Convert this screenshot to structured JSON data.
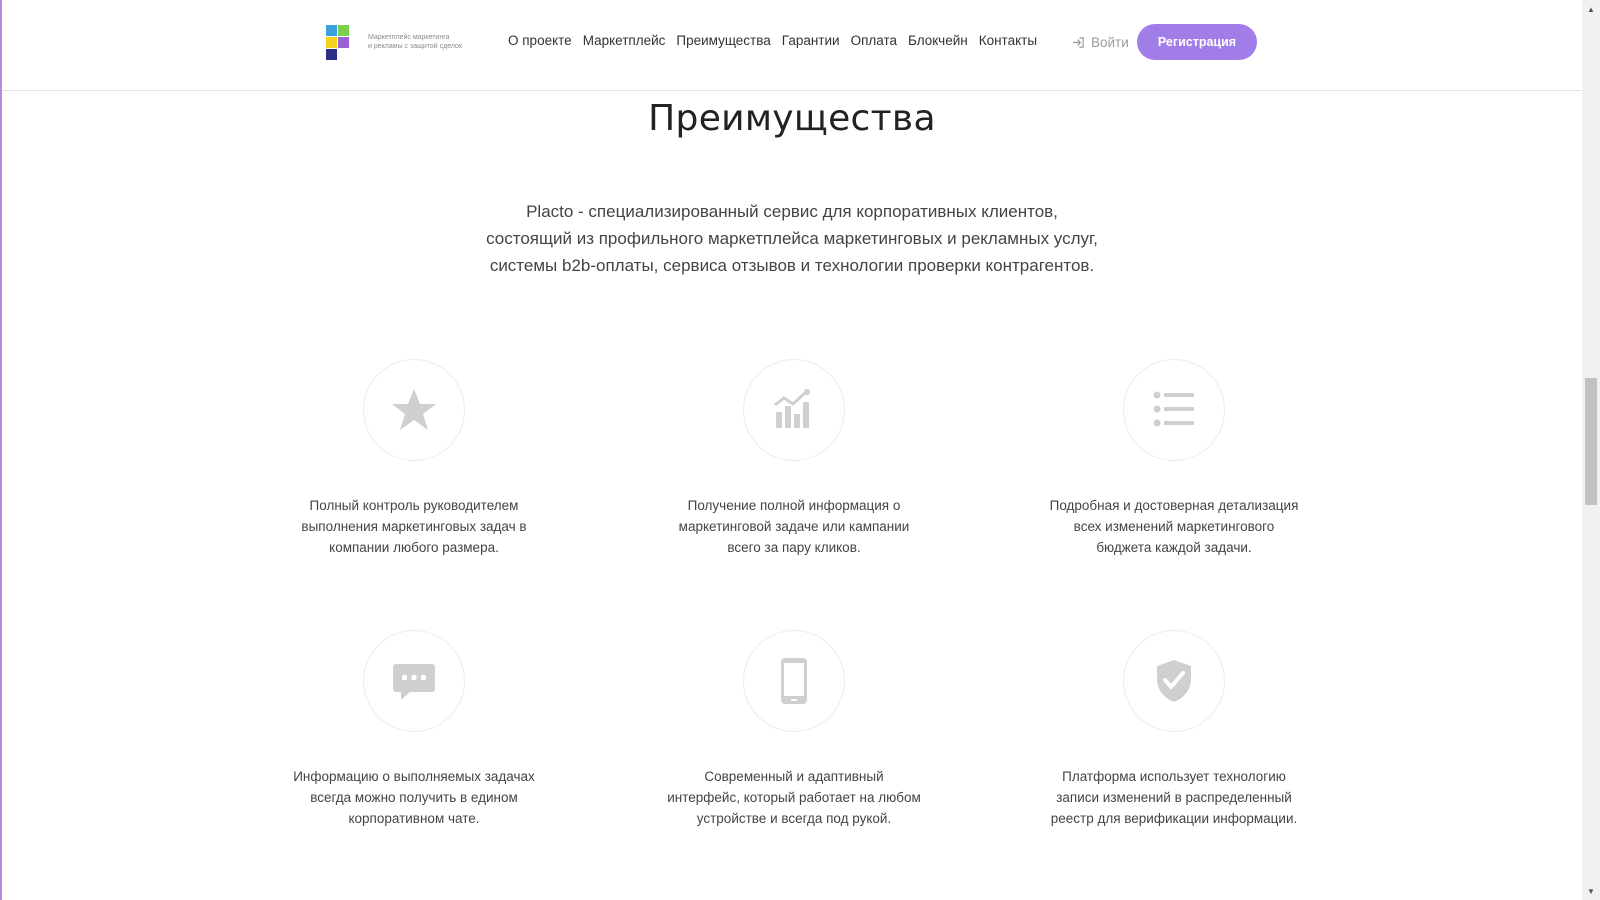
{
  "header": {
    "logo_lines": [
      "Маркетплейс маркетинга",
      "и рекламы с защитой сделок"
    ],
    "nav": [
      "О проекте",
      "Маркетплейс",
      "Преимущества",
      "Гарантии",
      "Оплата",
      "Блокчейн",
      "Контакты"
    ],
    "login_label": "Войти",
    "register_label": "Регистрация",
    "logo_colors": [
      "#3aa0e0",
      "#9b5fd6",
      "#7bd14a",
      "#f5d21f",
      "#2b2f86"
    ],
    "accent_color": "#a17de8"
  },
  "section": {
    "title": "Преимущества",
    "description_lines": [
      "Placto - специализированный сервис для корпоративных клиентов,",
      "состоящий из профильного маркетплейса маркетинговых и рекламных услуг,",
      "системы b2b-оплаты, сервиса отзывов и технологии проверки контрагентов."
    ]
  },
  "features": [
    {
      "icon": "star-icon",
      "lines": [
        "Полный контроль руководителем",
        "выполнения маркетинговых задач в",
        "компании любого размера."
      ]
    },
    {
      "icon": "chart-icon",
      "lines": [
        "Получение полной информация о",
        "маркетинговой задаче или кампании",
        "всего за пару кликов."
      ]
    },
    {
      "icon": "list-icon",
      "lines": [
        "Подробная и достоверная детализация",
        "всех изменений маркетингового",
        "бюджета каждой задачи."
      ]
    },
    {
      "icon": "chat-icon",
      "lines": [
        "Информацию о выполняемых задачах",
        "всегда можно получить в едином",
        "корпоративном чате."
      ]
    },
    {
      "icon": "mobile-icon",
      "lines": [
        "Современный и адаптивный",
        "интерфейс, который работает на любом",
        "устройстве и всегда под рукой."
      ]
    },
    {
      "icon": "shield-check-icon",
      "lines": [
        "Платформа использует технологию",
        "записи изменений в распределенный",
        "реестр для верификации информации."
      ]
    }
  ]
}
